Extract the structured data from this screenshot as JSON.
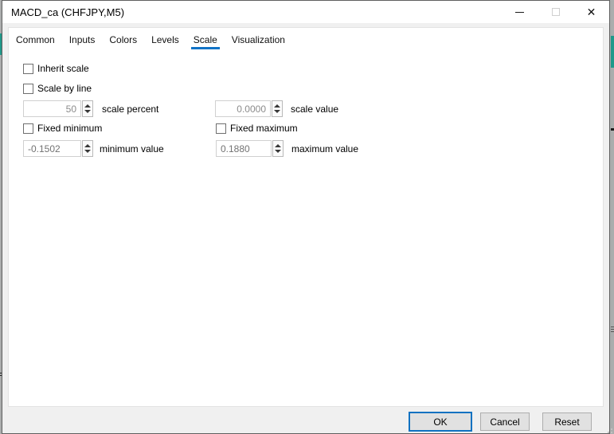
{
  "window": {
    "title": "MACD_ca (CHFJPY,M5)",
    "icons": {
      "minimize": "horizontal-bar",
      "maximize": "outline-square",
      "close": "✕"
    }
  },
  "tabs": {
    "active": "Scale",
    "items": [
      {
        "label": "Common"
      },
      {
        "label": "Inputs"
      },
      {
        "label": "Colors"
      },
      {
        "label": "Levels"
      },
      {
        "label": "Scale"
      },
      {
        "label": "Visualization"
      }
    ]
  },
  "scale_page": {
    "inherit_scale": {
      "label": "Inherit scale",
      "checked": false
    },
    "scale_by_line": {
      "label": "Scale by line",
      "checked": false
    },
    "scale_percent": {
      "value": "50",
      "label": "scale percent"
    },
    "scale_value": {
      "value": "0.0000",
      "label": "scale value"
    },
    "fixed_minimum": {
      "label": "Fixed minimum",
      "checked": false
    },
    "fixed_maximum": {
      "label": "Fixed maximum",
      "checked": false
    },
    "minimum_value": {
      "value": "-0.1502",
      "label": "minimum value"
    },
    "maximum_value": {
      "value": "0.1880",
      "label": "maximum value"
    }
  },
  "footer": {
    "ok_label": "OK",
    "cancel_label": "Cancel",
    "reset_label": "Reset"
  },
  "colors": {
    "accent_blue": "#1173c6",
    "teal_background": "#20998a"
  }
}
